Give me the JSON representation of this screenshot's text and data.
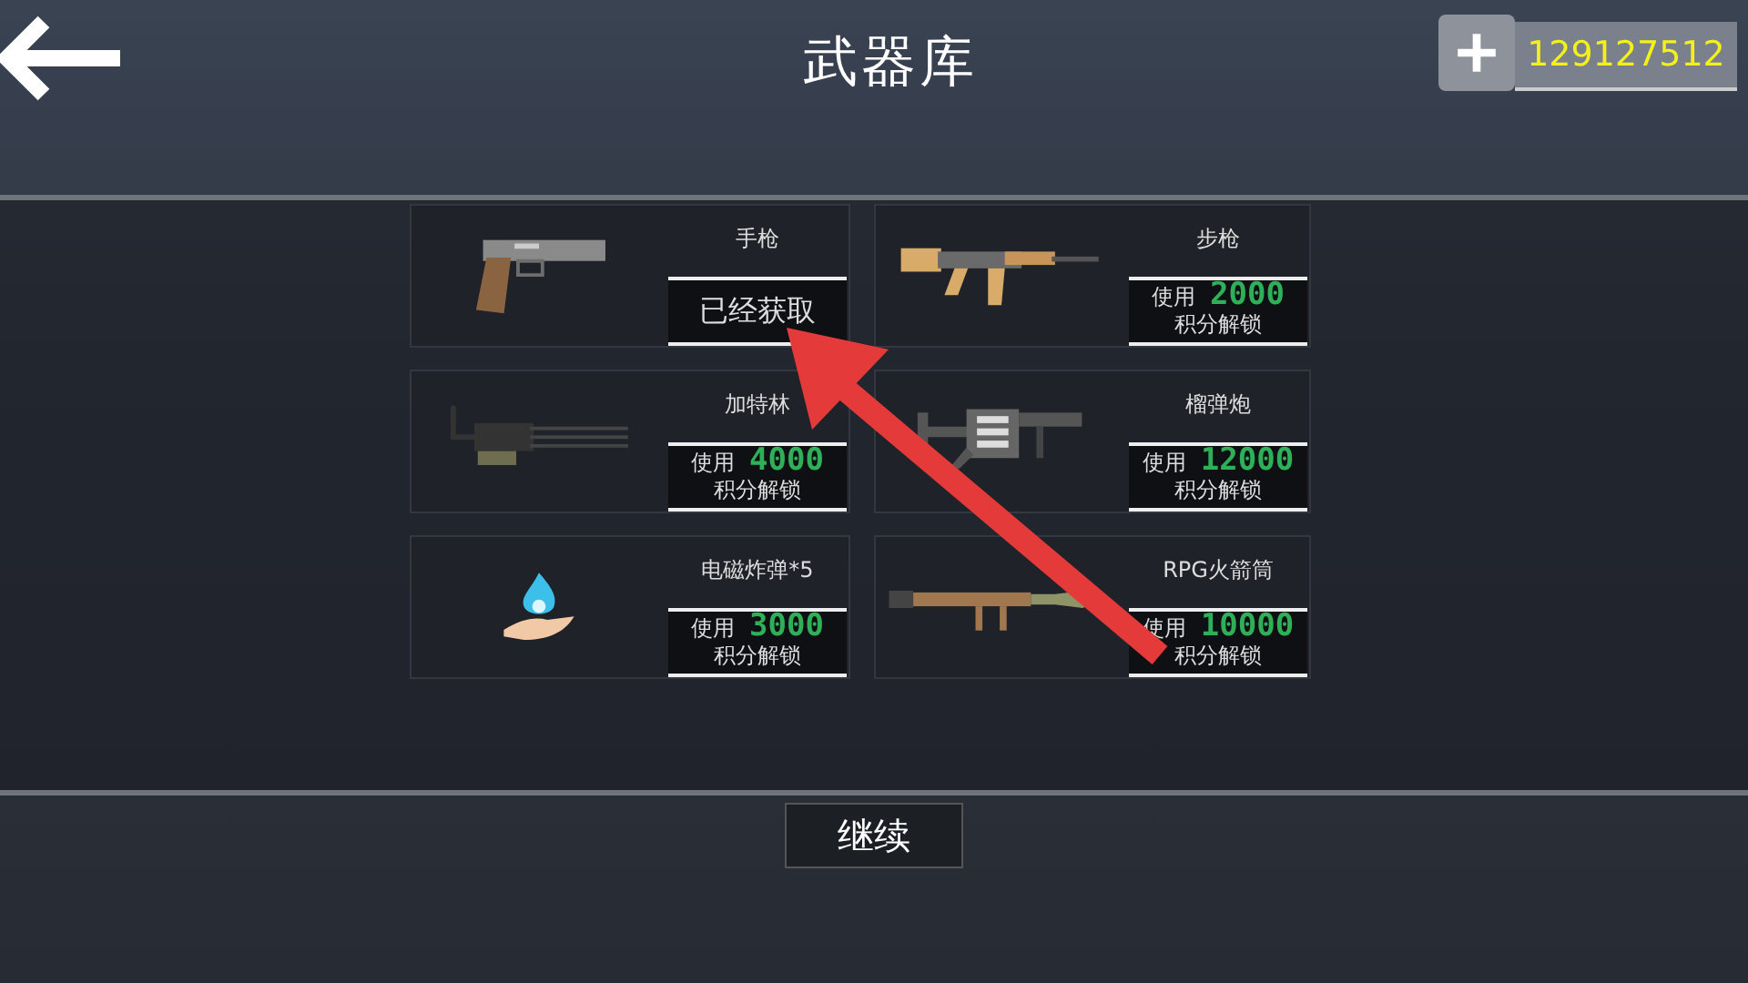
{
  "header": {
    "title": "武器库",
    "balance": "129127512"
  },
  "weapons": [
    {
      "name": "手枪",
      "kind": "owned",
      "status": "已经获取"
    },
    {
      "name": "步枪",
      "kind": "locked",
      "use": "使用",
      "cost": "2000",
      "unlock": "积分解锁"
    },
    {
      "name": "加特林",
      "kind": "locked",
      "use": "使用",
      "cost": "4000",
      "unlock": "积分解锁"
    },
    {
      "name": "榴弹炮",
      "kind": "locked",
      "use": "使用",
      "cost": "12000",
      "unlock": "积分解锁"
    },
    {
      "name": "电磁炸弹*5",
      "kind": "locked",
      "use": "使用",
      "cost": "3000",
      "unlock": "积分解锁"
    },
    {
      "name": "RPG火箭筒",
      "kind": "locked",
      "use": "使用",
      "cost": "10000",
      "unlock": "积分解锁"
    }
  ],
  "continue_button": "继续"
}
